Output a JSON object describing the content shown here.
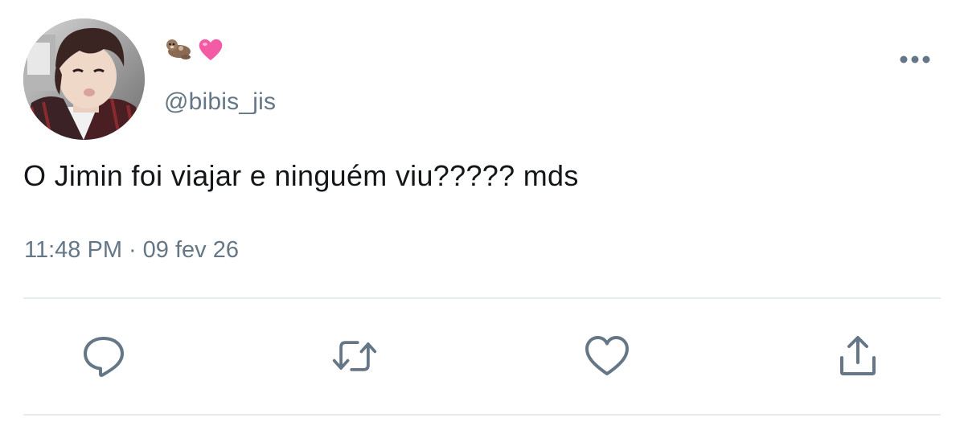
{
  "tweet": {
    "display_name_emojis": [
      "otter-emoji",
      "pink-heart-emoji"
    ],
    "handle": "@bibis_jis",
    "text": "O Jimin foi viajar e ninguém viu????? mds",
    "time": "11:48 PM",
    "separator": "·",
    "date": "09 fev 26"
  },
  "actions": {
    "icons": [
      "reply-icon",
      "retweet-icon",
      "like-icon",
      "share-icon"
    ]
  },
  "colors": {
    "text": "#14171a",
    "secondary": "#657786",
    "icon": "#657786",
    "divider": "#e6ecf0",
    "heart": "#f35ba5"
  }
}
